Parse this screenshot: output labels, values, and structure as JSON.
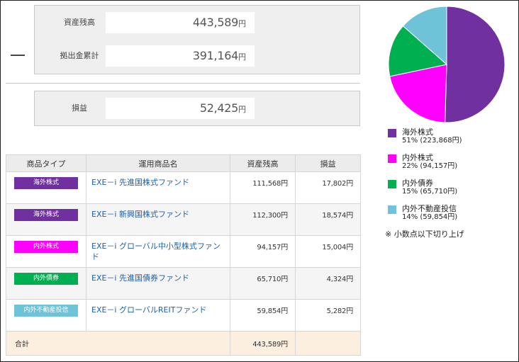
{
  "summary": {
    "asset_label": "資産残高",
    "asset_value": "443,589",
    "contrib_label": "拠出金累計",
    "contrib_value": "391,164",
    "pl_label": "損益",
    "pl_value": "52,425",
    "yen": "円"
  },
  "table": {
    "headers": [
      "商品タイプ",
      "運用商品名",
      "資産残高",
      "損益"
    ],
    "rows": [
      {
        "type": "海外株式",
        "type_color": "#7030a0",
        "fund": "EXE－i 先進国株式ファンド",
        "balance": "111,568円",
        "pl": "17,802円"
      },
      {
        "type": "海外株式",
        "type_color": "#7030a0",
        "fund": "EXE－i 新興国株式ファンド",
        "balance": "112,300円",
        "pl": "18,574円"
      },
      {
        "type": "内外株式",
        "type_color": "#ff00ff",
        "fund": "EXE－i グローバル中小型株式ファンド",
        "balance": "94,157円",
        "pl": "15,004円"
      },
      {
        "type": "内外債券",
        "type_color": "#00b050",
        "fund": "EXE－i 先進国債券ファンド",
        "balance": "65,710円",
        "pl": "4,324円"
      },
      {
        "type": "内外不動産投信",
        "type_color": "#6fc3d9",
        "fund": "EXE－i グローバルREITファンド",
        "balance": "59,854円",
        "pl": "5,282円"
      }
    ],
    "total_label": "合計",
    "total_balance": "443,589円"
  },
  "chart_data": {
    "type": "pie",
    "slices": [
      {
        "name": "海外株式",
        "percent": 51,
        "amount": 223868,
        "color": "#7030a0",
        "detail": "51% (223,868円)"
      },
      {
        "name": "内外株式",
        "percent": 22,
        "amount": 94157,
        "color": "#ff00ff",
        "detail": "22% (94,157円)"
      },
      {
        "name": "内外債券",
        "percent": 15,
        "amount": 65710,
        "color": "#00b050",
        "detail": "15% (65,710円)"
      },
      {
        "name": "内外不動産投信",
        "percent": 14,
        "amount": 59854,
        "color": "#6fc3d9",
        "detail": "14% (59,854円)"
      }
    ],
    "legend_placement": "bottom",
    "note": "※ 小数点以下切り上げ"
  }
}
